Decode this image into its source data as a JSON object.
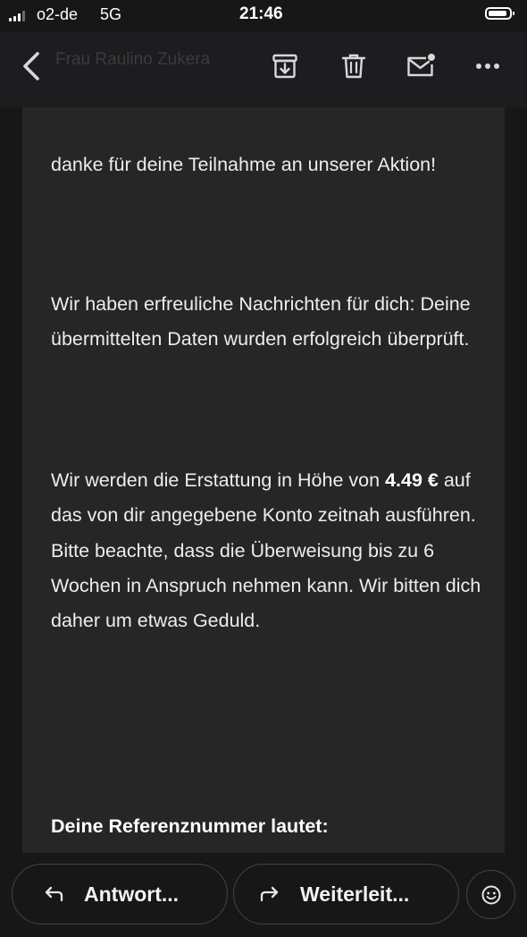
{
  "status_bar": {
    "carrier": "o2-de",
    "network": "5G",
    "time": "21:46"
  },
  "nav": {
    "title": "Frau Raulino Zukera",
    "icons": [
      "back-chevron-icon",
      "archive-icon",
      "trash-icon",
      "mark-unread-icon",
      "more-icon"
    ]
  },
  "message": {
    "paragraph_1": "danke für deine Teilnahme an unserer Aktion!",
    "paragraph_2": "Wir haben erfreuliche Nachrichten für dich: Deine übermittelten Daten wurden erfolgreich überprüft.",
    "paragraph_3_amount": "4.49 €",
    "paragraph_3_pre": "Wir werden die Erstattung in Höhe von",
    "paragraph_3_post": "auf das von dir angegebene Konto zeitnah ausführen. Bitte beachte, dass die Überweisung bis zu 6 Wochen in Anspruch nehmen kann. Wir bitten dich daher um etwas Geduld.",
    "reference_label": "Deine Referenznummer lautet:"
  },
  "bottom_bar": {
    "reply_label": "Antwort...",
    "forward_label": "Weiterleit..."
  }
}
